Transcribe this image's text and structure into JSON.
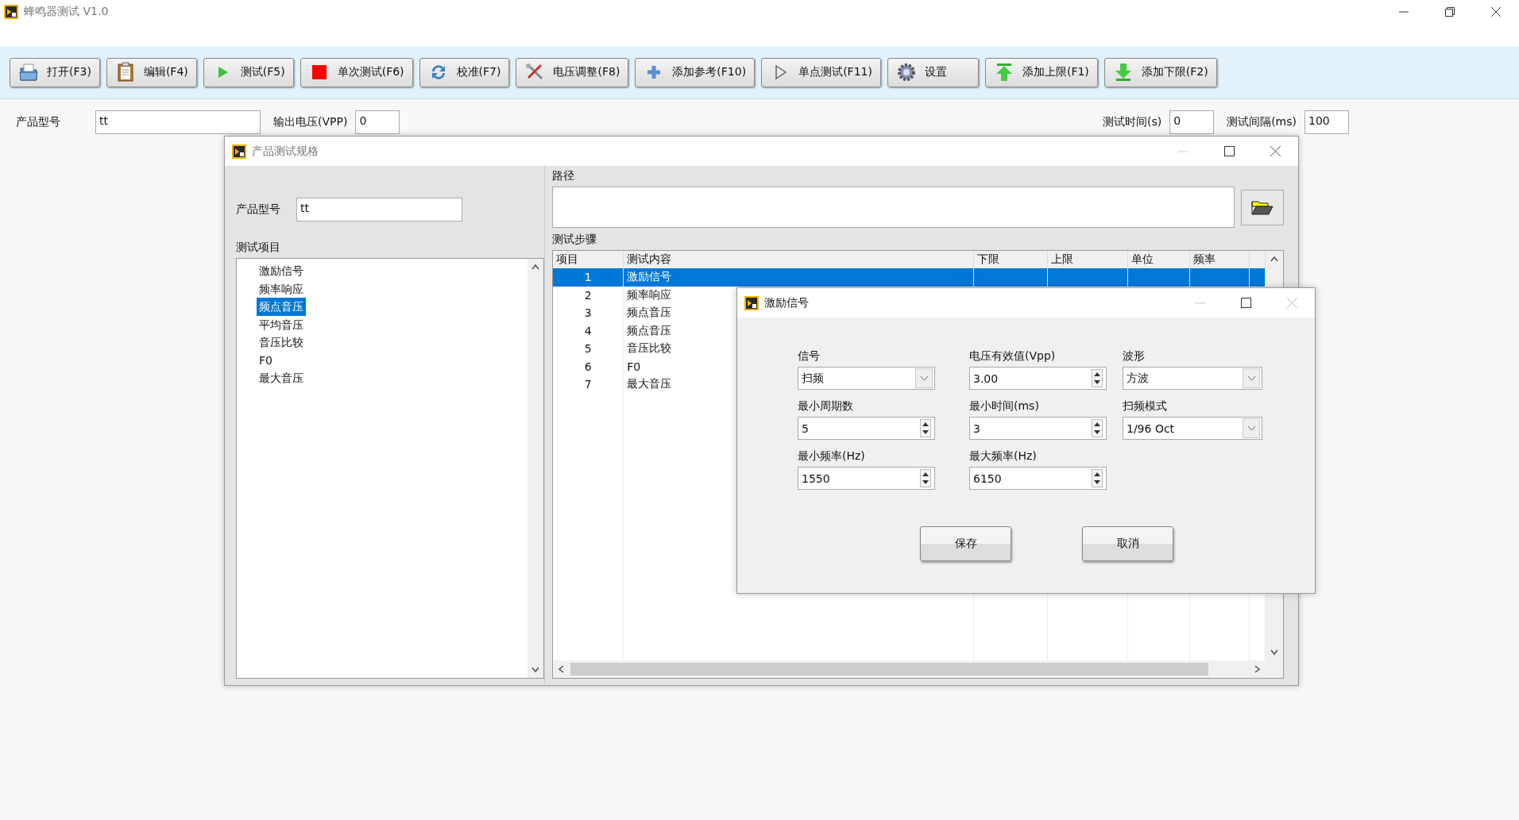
{
  "window": {
    "title": "蜂鸣器测试 V1.0"
  },
  "toolbar": [
    {
      "label": "打开(F3)",
      "kind": "open"
    },
    {
      "label": "编辑(F4)",
      "kind": "edit"
    },
    {
      "label": "测试(F5)",
      "kind": "run"
    },
    {
      "label": "单次测试(F6)",
      "kind": "stop"
    },
    {
      "label": "校准(F7)",
      "kind": "calibrate"
    },
    {
      "label": "电压调整(F8)",
      "kind": "tools"
    },
    {
      "label": "添加参考(F10)",
      "kind": "add"
    },
    {
      "label": "单点测试(F11)",
      "kind": "step"
    },
    {
      "label": "设置",
      "kind": "settings"
    },
    {
      "label": "添加上限(F1)",
      "kind": "upper"
    },
    {
      "label": "添加下限(F2)",
      "kind": "lower"
    }
  ],
  "form": {
    "left": [
      {
        "label": "产品型号",
        "value": "tt",
        "kind": "wide"
      },
      {
        "label": "输出电压(VPP)",
        "value": "0",
        "kind": "narrow"
      }
    ],
    "right": [
      {
        "label": "测试时间(s)",
        "value": "0",
        "kind": "narrow"
      },
      {
        "label": "测试间隔(ms)",
        "value": "100",
        "kind": "narrow"
      }
    ]
  },
  "spec_dialog": {
    "title": "产品测试规格",
    "product_model": {
      "label": "产品型号",
      "value": "tt"
    },
    "test_items": {
      "label": "测试项目",
      "items": [
        {
          "text": "激励信号",
          "selected": false
        },
        {
          "text": "频率响应",
          "selected": false
        },
        {
          "text": "频点音压",
          "selected": true
        },
        {
          "text": "平均音压",
          "selected": false
        },
        {
          "text": "音压比较",
          "selected": false
        },
        {
          "text": "F0",
          "selected": false
        },
        {
          "text": "最大音压",
          "selected": false
        }
      ]
    },
    "path": {
      "label": "路径"
    },
    "steps": {
      "label": "测试步骤",
      "columns": [
        "项目",
        "测试内容",
        "下限",
        "上限",
        "单位",
        "频率"
      ],
      "rows": [
        {
          "cells": [
            "1",
            "激励信号"
          ],
          "selected": true
        },
        {
          "cells": [
            "2",
            "频率响应"
          ],
          "selected": false
        },
        {
          "cells": [
            "3",
            "频点音压"
          ],
          "selected": false
        },
        {
          "cells": [
            "4",
            "频点音压"
          ],
          "selected": false
        },
        {
          "cells": [
            "5",
            "音压比较"
          ],
          "selected": false
        },
        {
          "cells": [
            "6",
            "F0"
          ],
          "selected": false
        },
        {
          "cells": [
            "7",
            "最大音压"
          ],
          "selected": false
        }
      ]
    }
  },
  "signal_dialog": {
    "title": "激励信号",
    "fields": [
      {
        "label": "信号",
        "value": "扫频",
        "kind": "dropdown"
      },
      {
        "label": "电压有效值(Vpp)",
        "value": "3.00",
        "kind": "spinner"
      },
      {
        "label": "波形",
        "value": "方波",
        "kind": "dropdown"
      },
      {
        "label": "最小周期数",
        "value": "5",
        "kind": "spinner"
      },
      {
        "label": "最小时间(ms)",
        "value": "3",
        "kind": "spinner"
      },
      {
        "label": "扫频模式",
        "value": "1/96 Oct",
        "kind": "dropdown"
      },
      {
        "label": "最小频率(Hz)",
        "value": "1550",
        "kind": "spinner"
      },
      {
        "label": "最大频率(Hz)",
        "value": "6150",
        "kind": "spinner"
      }
    ],
    "buttons": [
      "保存",
      "取消"
    ]
  }
}
